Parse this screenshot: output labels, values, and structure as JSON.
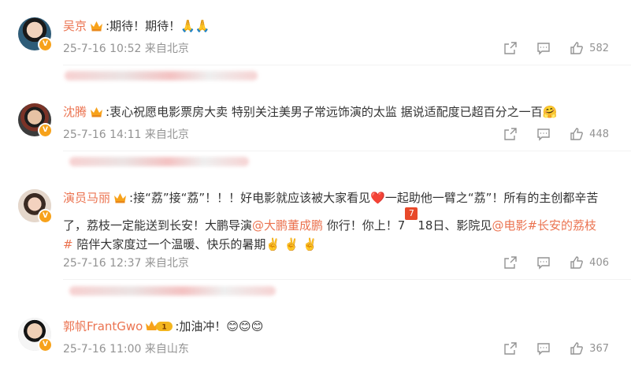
{
  "comments": [
    {
      "username": "吴京",
      "text": ":期待！期待！",
      "emoji": "🙏🙏",
      "time": "25-7-16 10:52 来自北京",
      "likes": "582"
    },
    {
      "username": "沈腾",
      "text": ":衷心祝愿电影票房大卖  特别关注美男子常远饰演的太监 据说适配度已超百分之一百",
      "emoji": "🤗",
      "time": "25-7-16 14:11 来自北京",
      "likes": "448"
    },
    {
      "username": "演员马丽",
      "text_a": ":接“荔”接“荔”！！！好电影就应该被大家看见",
      "text_b": "一起助他一臂之“荔”！所有的主创都辛苦了，荔枝一定能送到长安！大鹏导演",
      "mention_1": "@大鹏董成鹏",
      "text_c": " 你行！你上！7",
      "date_icon": "7月",
      "text_d": "18日、影院见",
      "mention_2": "@电影#长安的荔枝#",
      "text_e": " 陪伴大家度过一个温暖、快乐的暑期",
      "emoji_heart": "❤️",
      "emoji_victory": "✌️ ✌️ ✌️",
      "time": "25-7-16 12:37 来自北京",
      "likes": "406"
    },
    {
      "username": "郭帆FrantGwo",
      "text": ":加油冲！",
      "emoji": "😊😊😊",
      "time": "25-7-16 11:00 来自山东",
      "likes": "367"
    }
  ],
  "colors": {
    "accent": "#eb7350",
    "meta": "#939393",
    "crown": "#f7a21b"
  }
}
